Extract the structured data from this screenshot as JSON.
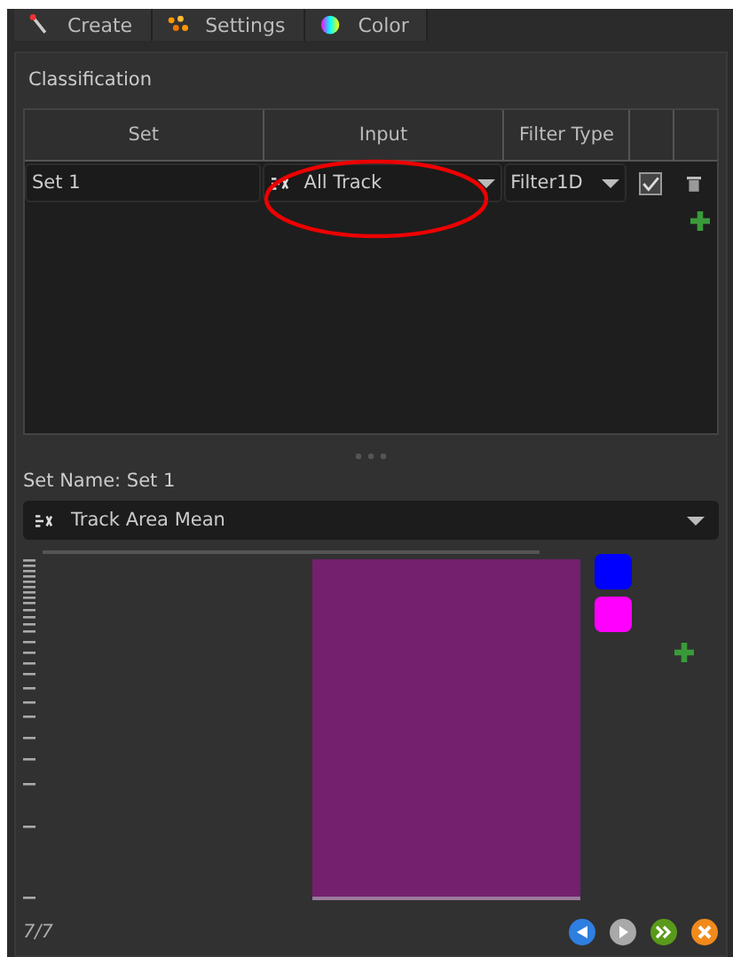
{
  "tabs": [
    {
      "label": "Create",
      "kind": "wand"
    },
    {
      "label": "Settings",
      "kind": "dots"
    },
    {
      "label": "Color",
      "kind": "wheel"
    }
  ],
  "section_title": "Classification",
  "table": {
    "columns": [
      "Set",
      "Input",
      "Filter Type"
    ],
    "rows": [
      {
        "set": "Set 1",
        "input": "All Track",
        "filter_type": "Filter1D",
        "checked": true
      }
    ]
  },
  "set_name": "Set Name: Set 1",
  "statistic": "Track Area Mean",
  "classes": [
    {
      "color": "#0000ff"
    },
    {
      "color": "#ff00ff"
    }
  ],
  "page_counter": "7/7",
  "footer_buttons": [
    {
      "kind": "back",
      "color": "#2e7fe0"
    },
    {
      "kind": "play",
      "color": "#a9a9a9"
    },
    {
      "kind": "forward",
      "color": "#5a9a1a"
    },
    {
      "kind": "close",
      "color": "#f08a1a"
    }
  ]
}
